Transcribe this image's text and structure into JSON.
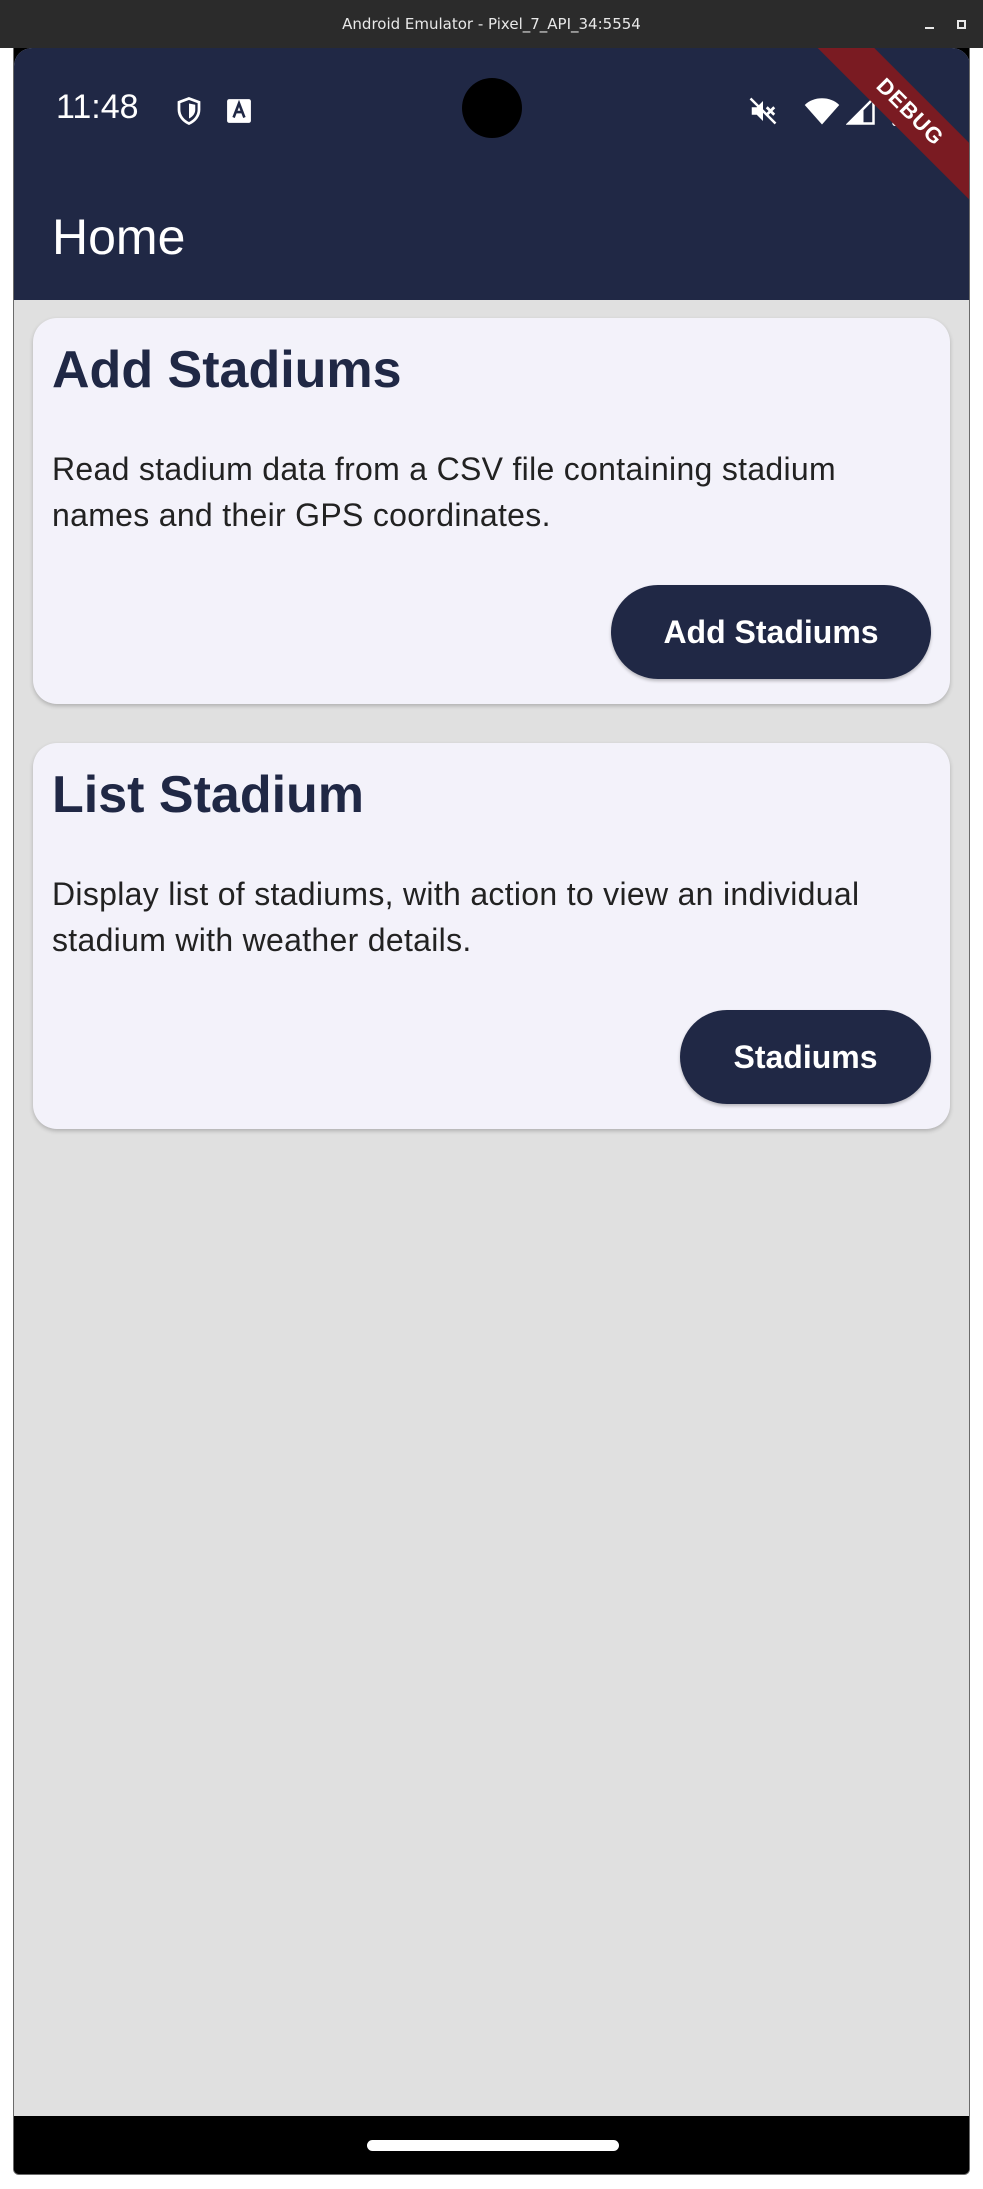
{
  "window": {
    "title": "Android Emulator - Pixel_7_API_34:5554"
  },
  "status_bar": {
    "time": "11:48",
    "icons": [
      "shield-icon",
      "font-a-icon",
      "mute-icon",
      "wifi-icon",
      "signal-icon",
      "battery-icon"
    ]
  },
  "app_bar": {
    "title": "Home",
    "debug_banner": "DEBUG"
  },
  "cards": [
    {
      "title": "Add Stadiums",
      "description": "Read stadium data from a CSV file containing stadium names and their GPS coordinates.",
      "button_label": "Add Stadiums"
    },
    {
      "title": "List Stadium",
      "description": "Display list of stadiums, with action to view an individual stadium with weather details.",
      "button_label": "Stadiums"
    }
  ],
  "colors": {
    "app_bar": "#202845",
    "background": "#e0e0e0",
    "card": "#f3f2fa",
    "button": "#202845",
    "debug_ribbon": "#7a1b22"
  }
}
